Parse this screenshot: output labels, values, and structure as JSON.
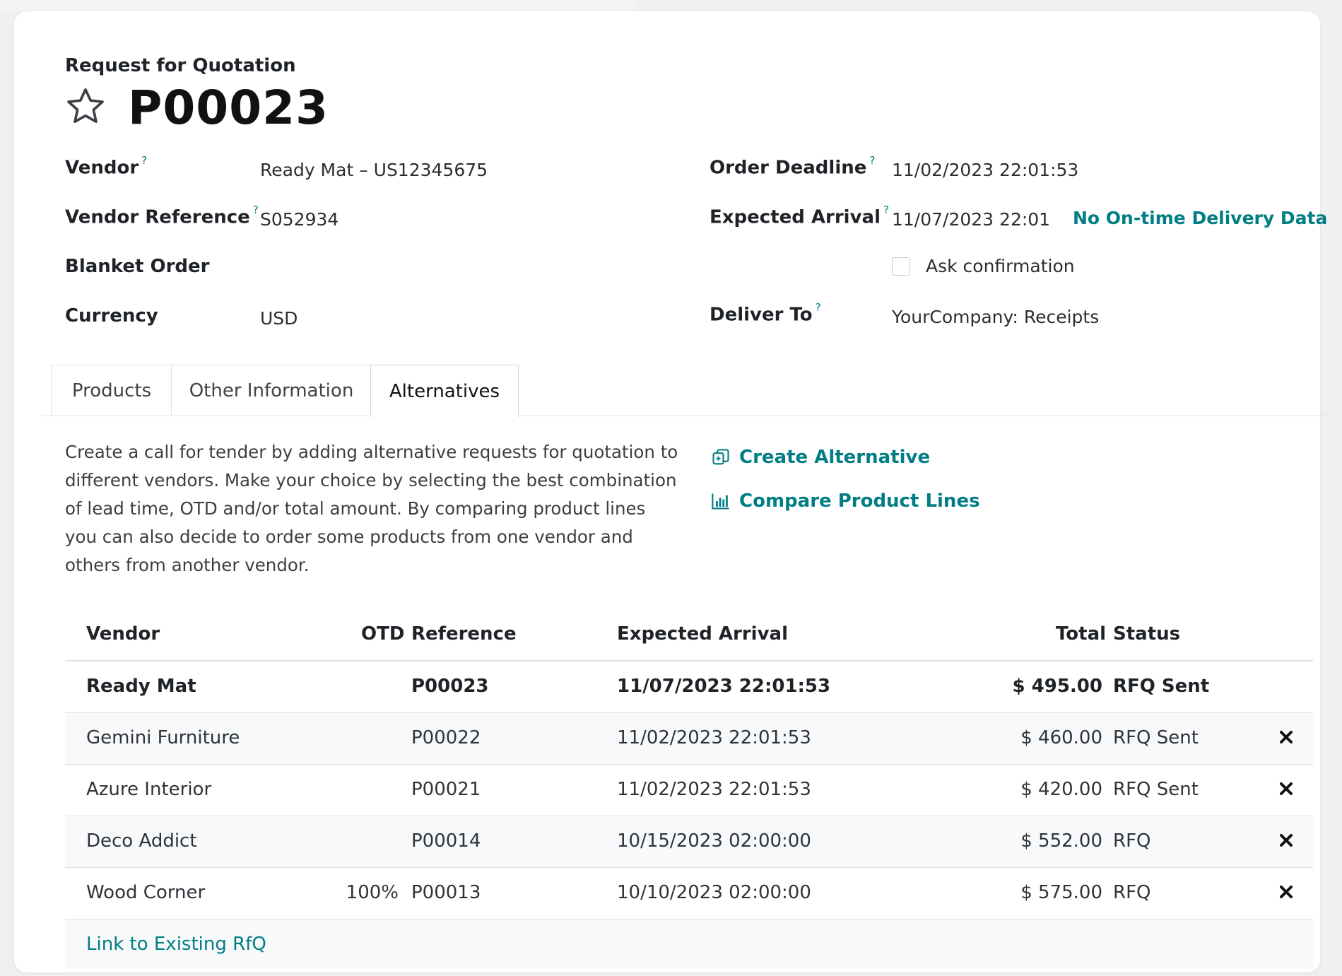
{
  "header": {
    "subtitle": "Request for Quotation",
    "record_name": "P00023",
    "favorite_icon": "star-outline-icon"
  },
  "fields_left": {
    "vendor_label": "Vendor",
    "vendor_value": "Ready Mat – US12345675",
    "vendor_reference_label": "Vendor Reference",
    "vendor_reference_value": "S052934",
    "blanket_order_label": "Blanket Order",
    "currency_label": "Currency",
    "currency_value": "USD"
  },
  "fields_right": {
    "order_deadline_label": "Order Deadline",
    "order_deadline_value": "11/02/2023 22:01:53",
    "expected_arrival_label": "Expected Arrival",
    "expected_arrival_value": "11/07/2023 22:01:5",
    "otd_note": "No On-time Delivery Data",
    "ask_confirmation_label": "Ask confirmation",
    "ask_confirmation_checked": false,
    "deliver_to_label": "Deliver To",
    "deliver_to_value": "YourCompany: Receipts"
  },
  "help_marker": "?",
  "tabs": [
    {
      "label": "Products",
      "active": false
    },
    {
      "label": "Other Information",
      "active": false
    },
    {
      "label": "Alternatives",
      "active": true
    }
  ],
  "alternatives": {
    "help_text": "Create a call for tender by adding alternative requests for quotation to different vendors. Make your choice by selecting the best combination of lead time, OTD and/or total amount. By comparing product lines you can also decide to order some products from one vendor and others from another vendor.",
    "create_alternative_label": "Create Alternative",
    "compare_lines_label": "Compare Product Lines",
    "columns": {
      "vendor": "Vendor",
      "otd": "OTD",
      "reference": "Reference",
      "expected_arrival": "Expected Arrival",
      "total": "Total",
      "status": "Status"
    },
    "rows": [
      {
        "vendor": "Ready Mat",
        "otd": "",
        "reference": "P00023",
        "expected_arrival": "11/07/2023 22:01:53",
        "total": "$ 495.00",
        "status": "RFQ Sent",
        "current": true
      },
      {
        "vendor": "Gemini Furniture",
        "otd": "",
        "reference": "P00022",
        "expected_arrival": "11/02/2023 22:01:53",
        "total": "$ 460.00",
        "status": "RFQ Sent",
        "current": false
      },
      {
        "vendor": "Azure Interior",
        "otd": "",
        "reference": "P00021",
        "expected_arrival": "11/02/2023 22:01:53",
        "total": "$ 420.00",
        "status": "RFQ Sent",
        "current": false
      },
      {
        "vendor": "Deco Addict",
        "otd": "",
        "reference": "P00014",
        "expected_arrival": "10/15/2023 02:00:00",
        "total": "$ 552.00",
        "status": "RFQ",
        "current": false
      },
      {
        "vendor": "Wood Corner",
        "otd": "100%",
        "reference": "P00013",
        "expected_arrival": "10/10/2023 02:00:00",
        "total": "$ 575.00",
        "status": "RFQ",
        "current": false
      }
    ],
    "link_existing_label": "Link to Existing RfQ"
  },
  "colors": {
    "accent": "#017e84"
  }
}
